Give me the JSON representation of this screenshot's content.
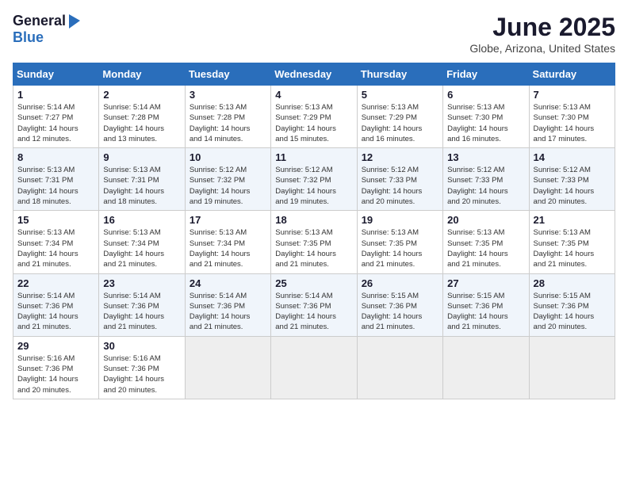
{
  "header": {
    "logo_general": "General",
    "logo_blue": "Blue",
    "month": "June 2025",
    "location": "Globe, Arizona, United States"
  },
  "weekdays": [
    "Sunday",
    "Monday",
    "Tuesday",
    "Wednesday",
    "Thursday",
    "Friday",
    "Saturday"
  ],
  "weeks": [
    [
      {
        "day": "1",
        "info": "Sunrise: 5:14 AM\nSunset: 7:27 PM\nDaylight: 14 hours\nand 12 minutes."
      },
      {
        "day": "2",
        "info": "Sunrise: 5:14 AM\nSunset: 7:28 PM\nDaylight: 14 hours\nand 13 minutes."
      },
      {
        "day": "3",
        "info": "Sunrise: 5:13 AM\nSunset: 7:28 PM\nDaylight: 14 hours\nand 14 minutes."
      },
      {
        "day": "4",
        "info": "Sunrise: 5:13 AM\nSunset: 7:29 PM\nDaylight: 14 hours\nand 15 minutes."
      },
      {
        "day": "5",
        "info": "Sunrise: 5:13 AM\nSunset: 7:29 PM\nDaylight: 14 hours\nand 16 minutes."
      },
      {
        "day": "6",
        "info": "Sunrise: 5:13 AM\nSunset: 7:30 PM\nDaylight: 14 hours\nand 16 minutes."
      },
      {
        "day": "7",
        "info": "Sunrise: 5:13 AM\nSunset: 7:30 PM\nDaylight: 14 hours\nand 17 minutes."
      }
    ],
    [
      {
        "day": "8",
        "info": "Sunrise: 5:13 AM\nSunset: 7:31 PM\nDaylight: 14 hours\nand 18 minutes."
      },
      {
        "day": "9",
        "info": "Sunrise: 5:13 AM\nSunset: 7:31 PM\nDaylight: 14 hours\nand 18 minutes."
      },
      {
        "day": "10",
        "info": "Sunrise: 5:12 AM\nSunset: 7:32 PM\nDaylight: 14 hours\nand 19 minutes."
      },
      {
        "day": "11",
        "info": "Sunrise: 5:12 AM\nSunset: 7:32 PM\nDaylight: 14 hours\nand 19 minutes."
      },
      {
        "day": "12",
        "info": "Sunrise: 5:12 AM\nSunset: 7:33 PM\nDaylight: 14 hours\nand 20 minutes."
      },
      {
        "day": "13",
        "info": "Sunrise: 5:12 AM\nSunset: 7:33 PM\nDaylight: 14 hours\nand 20 minutes."
      },
      {
        "day": "14",
        "info": "Sunrise: 5:12 AM\nSunset: 7:33 PM\nDaylight: 14 hours\nand 20 minutes."
      }
    ],
    [
      {
        "day": "15",
        "info": "Sunrise: 5:13 AM\nSunset: 7:34 PM\nDaylight: 14 hours\nand 21 minutes."
      },
      {
        "day": "16",
        "info": "Sunrise: 5:13 AM\nSunset: 7:34 PM\nDaylight: 14 hours\nand 21 minutes."
      },
      {
        "day": "17",
        "info": "Sunrise: 5:13 AM\nSunset: 7:34 PM\nDaylight: 14 hours\nand 21 minutes."
      },
      {
        "day": "18",
        "info": "Sunrise: 5:13 AM\nSunset: 7:35 PM\nDaylight: 14 hours\nand 21 minutes."
      },
      {
        "day": "19",
        "info": "Sunrise: 5:13 AM\nSunset: 7:35 PM\nDaylight: 14 hours\nand 21 minutes."
      },
      {
        "day": "20",
        "info": "Sunrise: 5:13 AM\nSunset: 7:35 PM\nDaylight: 14 hours\nand 21 minutes."
      },
      {
        "day": "21",
        "info": "Sunrise: 5:13 AM\nSunset: 7:35 PM\nDaylight: 14 hours\nand 21 minutes."
      }
    ],
    [
      {
        "day": "22",
        "info": "Sunrise: 5:14 AM\nSunset: 7:36 PM\nDaylight: 14 hours\nand 21 minutes."
      },
      {
        "day": "23",
        "info": "Sunrise: 5:14 AM\nSunset: 7:36 PM\nDaylight: 14 hours\nand 21 minutes."
      },
      {
        "day": "24",
        "info": "Sunrise: 5:14 AM\nSunset: 7:36 PM\nDaylight: 14 hours\nand 21 minutes."
      },
      {
        "day": "25",
        "info": "Sunrise: 5:14 AM\nSunset: 7:36 PM\nDaylight: 14 hours\nand 21 minutes."
      },
      {
        "day": "26",
        "info": "Sunrise: 5:15 AM\nSunset: 7:36 PM\nDaylight: 14 hours\nand 21 minutes."
      },
      {
        "day": "27",
        "info": "Sunrise: 5:15 AM\nSunset: 7:36 PM\nDaylight: 14 hours\nand 21 minutes."
      },
      {
        "day": "28",
        "info": "Sunrise: 5:15 AM\nSunset: 7:36 PM\nDaylight: 14 hours\nand 20 minutes."
      }
    ],
    [
      {
        "day": "29",
        "info": "Sunrise: 5:16 AM\nSunset: 7:36 PM\nDaylight: 14 hours\nand 20 minutes."
      },
      {
        "day": "30",
        "info": "Sunrise: 5:16 AM\nSunset: 7:36 PM\nDaylight: 14 hours\nand 20 minutes."
      },
      {
        "day": "",
        "info": ""
      },
      {
        "day": "",
        "info": ""
      },
      {
        "day": "",
        "info": ""
      },
      {
        "day": "",
        "info": ""
      },
      {
        "day": "",
        "info": ""
      }
    ]
  ]
}
